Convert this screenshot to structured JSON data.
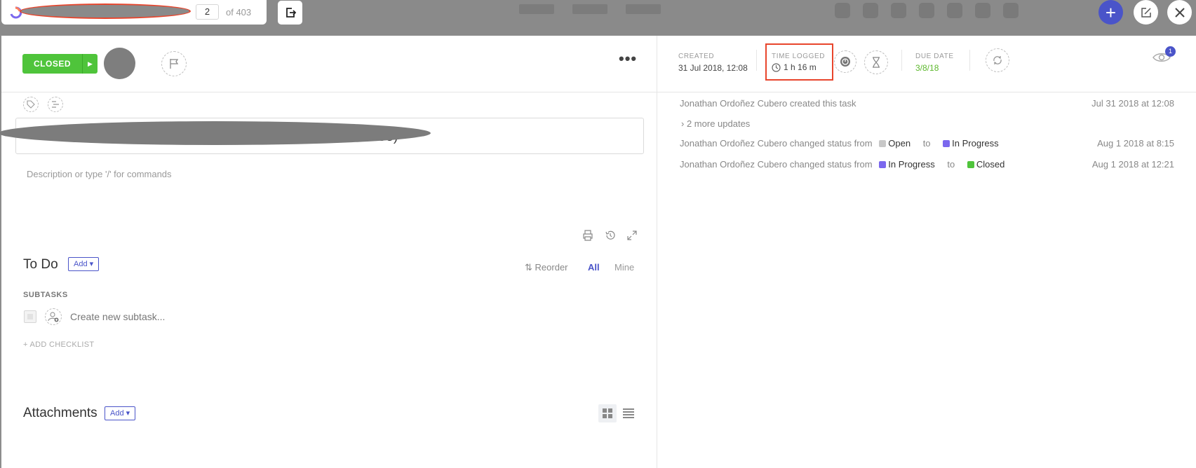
{
  "nav": {
    "page_number": "2",
    "page_total": "of 403"
  },
  "header": {
    "status_label": "CLOSED",
    "created_label": "CREATED",
    "created_value": "31 Jul 2018, 12:08",
    "time_logged_label": "TIME LOGGED",
    "time_logged_value": "1 h 16 m",
    "due_label": "DUE DATE",
    "due_value": "3/8/18",
    "watchers_count": "1",
    "more_label": "•••"
  },
  "task": {
    "title_tail": "ree)",
    "description_placeholder": "Description or type '/' for commands"
  },
  "todo": {
    "title": "To Do",
    "add_label": "Add ▾",
    "reorder_label": "Reorder",
    "filter_all": "All",
    "filter_mine": "Mine",
    "subtasks_heading": "SUBTASKS",
    "new_subtask_placeholder": "Create new subtask...",
    "add_checklist": "+ ADD CHECKLIST"
  },
  "attachments": {
    "title": "Attachments",
    "add_label": "Add ▾"
  },
  "activity": {
    "items": [
      {
        "text": "Jonathan Ordoñez Cubero created this task",
        "time": "Jul 31 2018 at 12:08"
      },
      {
        "text": "2 more updates"
      },
      {
        "actor": "Jonathan Ordoñez Cubero changed status from",
        "from": "Open",
        "to_word": "to",
        "to": "In Progress",
        "time": "Aug 1 2018 at 8:15"
      },
      {
        "actor": "Jonathan Ordoñez Cubero changed status from",
        "from": "In Progress",
        "to_word": "to",
        "to": "Closed",
        "time": "Aug 1 2018 at 12:21"
      }
    ]
  },
  "colors": {
    "accent": "#4a54c9",
    "closed_green": "#4fc43b",
    "open_gray": "#c8c8c8",
    "in_progress_purple": "#7b68ee",
    "highlight_red": "#e8452c"
  },
  "icons": [
    "app-logo-icon",
    "export-icon",
    "plus-icon",
    "edit-icon",
    "close-icon",
    "flag-icon",
    "tag-icon",
    "relate-icon",
    "clock-icon",
    "timer-icon",
    "hourglass-icon",
    "recurring-icon",
    "eye-icon",
    "print-icon",
    "history-icon",
    "expand-icon",
    "assign-user-icon",
    "grid-view-icon",
    "list-view-icon",
    "reorder-icon",
    "chevron-right-icon"
  ]
}
